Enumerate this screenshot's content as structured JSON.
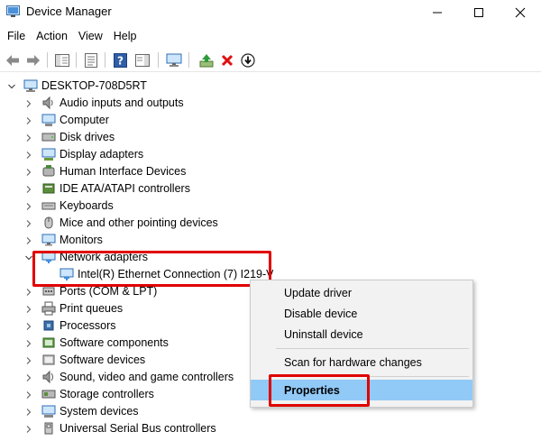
{
  "window": {
    "title": "Device Manager",
    "icon": "device-manager-icon"
  },
  "menu": [
    "File",
    "Action",
    "View",
    "Help"
  ],
  "toolbar": {
    "buttons": [
      "back-arrow-icon",
      "forward-arrow-icon",
      "show-hide-console-tree-icon",
      "properties-icon",
      "help-icon",
      "action-pane-icon",
      "monitor-scan-icon",
      "update-driver-icon",
      "uninstall-red-x-icon",
      "disable-device-down-arrow-icon"
    ]
  },
  "tree": {
    "root": "DESKTOP-708D5RT",
    "categories": [
      "Audio inputs and outputs",
      "Computer",
      "Disk drives",
      "Display adapters",
      "Human Interface Devices",
      "IDE ATA/ATAPI controllers",
      "Keyboards",
      "Mice and other pointing devices",
      "Monitors",
      "Network adapters",
      "Ports (COM & LPT)",
      "Print queues",
      "Processors",
      "Software components",
      "Software devices",
      "Sound, video and game controllers",
      "Storage controllers",
      "System devices",
      "Universal Serial Bus controllers"
    ],
    "expanded_child": "Intel(R) Ethernet Connection (7) I219-V"
  },
  "context_menu": {
    "items": [
      "Update driver",
      "Disable device",
      "Uninstall device",
      "Scan for hardware changes",
      "Properties"
    ],
    "selected": "Properties"
  },
  "colors": {
    "highlight_box": "#e00000",
    "menu_selection": "#91c9f7",
    "folder_icon_accent": "#3d8ee0"
  }
}
